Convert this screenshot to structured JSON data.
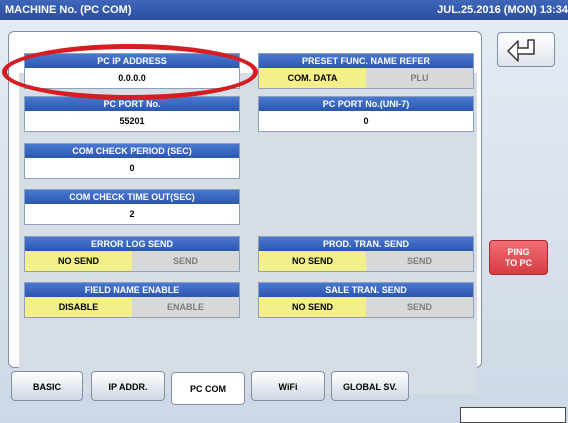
{
  "titlebar": {
    "title": "MACHINE No. (PC COM)",
    "datetime": "JUL.25.2016 (MON) 13:34"
  },
  "fields": {
    "pc_ip": {
      "label": "PC IP ADDRESS",
      "value": "0.0.0.0"
    },
    "pc_port": {
      "label": "PC PORT No.",
      "value": "55201"
    },
    "check_period": {
      "label": "COM CHECK PERIOD (SEC)",
      "value": "0"
    },
    "check_timeout": {
      "label": "COM CHECK TIME OUT(SEC)",
      "value": "2"
    },
    "preset_func": {
      "label": "PRESET FUNC. NAME REFER",
      "opt1": "COM. DATA",
      "opt2": "PLU"
    },
    "pc_port_uni7": {
      "label": "PC PORT No.(UNI-7)",
      "value": "0"
    },
    "error_log": {
      "label": "ERROR LOG SEND",
      "opt1": "NO SEND",
      "opt2": "SEND"
    },
    "prod_tran": {
      "label": "PROD. TRAN. SEND",
      "opt1": "NO SEND",
      "opt2": "SEND"
    },
    "field_name": {
      "label": "FIELD NAME ENABLE",
      "opt1": "DISABLE",
      "opt2": "ENABLE"
    },
    "sale_tran": {
      "label": "SALE TRAN. SEND",
      "opt1": "NO SEND",
      "opt2": "SEND"
    }
  },
  "ping_button": {
    "line1": "PING",
    "line2": "TO PC"
  },
  "tabs": [
    "BASIC",
    "IP ADDR.",
    "PC COM",
    "WiFi",
    "GLOBAL SV."
  ],
  "colors": {
    "header_blue": "#2b56b0",
    "selected_yellow": "#f3f08a",
    "ping_red": "#d73b43",
    "annotation_red": "#d51d22"
  }
}
